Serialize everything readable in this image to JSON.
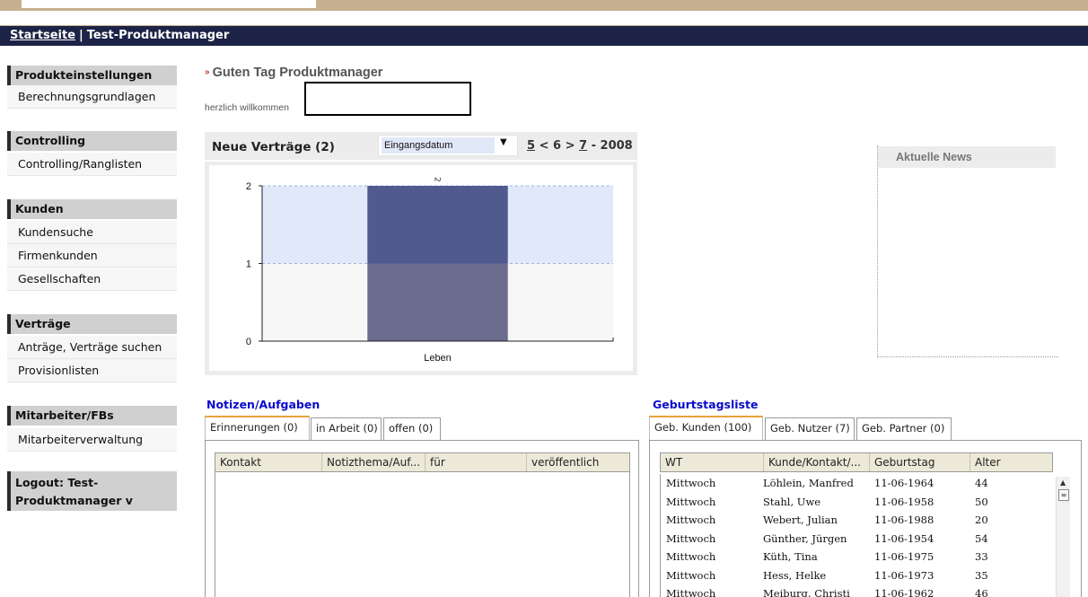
{
  "breadcrumb": {
    "home": "Startseite",
    "separator": "|",
    "current": "Test-Produktmanager"
  },
  "sidebar": {
    "groups": [
      {
        "title": "Produkteinstellungen",
        "items": [
          "Berechnungsgrundlagen"
        ]
      },
      {
        "title": "Controlling",
        "items": [
          "Controlling/Ranglisten"
        ]
      },
      {
        "title": "Kunden",
        "items": [
          "Kundensuche",
          "Firmenkunden",
          "Gesellschaften"
        ]
      },
      {
        "title": "Verträge",
        "items": [
          "Anträge, Verträge suchen",
          "Provisionlisten"
        ]
      },
      {
        "title": "Mitarbeiter/FBs",
        "items": [
          "Mitarbeiterverwaltung"
        ]
      }
    ],
    "logout": [
      "Logout: Test-",
      "Produktmanager v"
    ]
  },
  "greeting": {
    "title": "Guten Tag Produktmanager",
    "welcome": "herzlich willkommen"
  },
  "contracts": {
    "title": "Neue Verträge (2)",
    "select_value": "Eingangsdatum",
    "nav": {
      "prev": "5",
      "lt": "<",
      "current": "6",
      "gt": ">",
      "next": "7",
      "year": "- 2008"
    }
  },
  "chart_data": {
    "type": "bar",
    "categories": [
      "Leben"
    ],
    "values": [
      2
    ],
    "data_labels": [
      "2"
    ],
    "ylim": [
      0,
      2
    ],
    "yticks": [
      "0",
      "1",
      "2"
    ],
    "colors": {
      "bar_top": "#505a8e",
      "bar_bottom": "#6b6b8e",
      "band": "#e1e8fa"
    }
  },
  "news": {
    "title": "Aktuelle News"
  },
  "notes": {
    "title": "Notizen/Aufgaben",
    "tabs": [
      "Erinnerungen (0)",
      "in Arbeit (0)",
      "offen (0)"
    ],
    "columns": [
      "Kontakt",
      "Notizthema/Auf...",
      "für",
      "veröffentlich"
    ]
  },
  "birthdays": {
    "title": "Geburtstagsliste",
    "tabs": [
      "Geb. Kunden (100)",
      "Geb. Nutzer (7)",
      "Geb. Partner (0)"
    ],
    "columns": [
      "WT",
      "Kunde/Kontakt/...",
      "Geburtstag",
      "Alter"
    ],
    "rows": [
      [
        "Mittwoch",
        "Löhlein, Manfred",
        "11-06-1964",
        "44"
      ],
      [
        "Mittwoch",
        "Stahl, Uwe",
        "11-06-1958",
        "50"
      ],
      [
        "Mittwoch",
        "Webert, Julian",
        "11-06-1988",
        "20"
      ],
      [
        "Mittwoch",
        "Günther, Jürgen",
        "11-06-1954",
        "54"
      ],
      [
        "Mittwoch",
        "Küth, Tina",
        "11-06-1975",
        "33"
      ],
      [
        "Mittwoch",
        "Hess, Helke",
        "11-06-1973",
        "35"
      ],
      [
        "Mittwoch",
        "Meiburg, Christi",
        "11-06-1962",
        "46"
      ]
    ]
  }
}
